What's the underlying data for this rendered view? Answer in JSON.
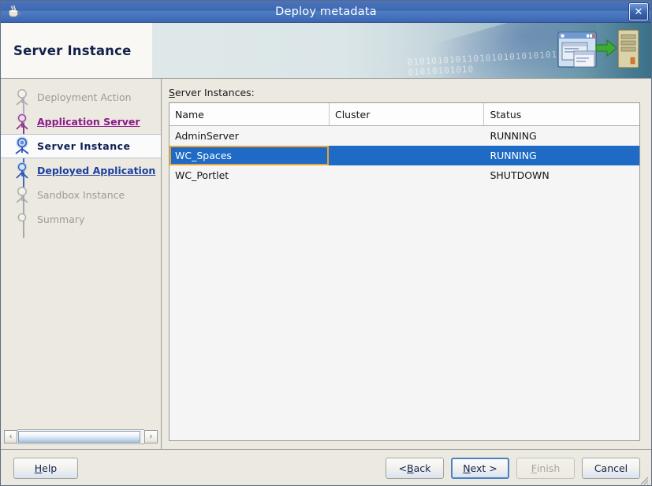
{
  "window": {
    "title": "Deploy metadata",
    "app_icon": "java-coffee-cup-icon",
    "close_label": "✕"
  },
  "banner": {
    "title": "Server Instance",
    "binary_line1": "0101010101101010101010101010",
    "binary_line2": "01010101010",
    "art_icon": "deploy-to-server-icon"
  },
  "sidebar": {
    "steps": [
      {
        "label": "Deployment Action",
        "state": "future"
      },
      {
        "label": "Application Server",
        "state": "done"
      },
      {
        "label": "Server Instance",
        "state": "current"
      },
      {
        "label": "Deployed Application",
        "state": "done-blue"
      },
      {
        "label": "Sandbox Instance",
        "state": "future"
      },
      {
        "label": "Summary",
        "state": "future"
      }
    ],
    "scrollbar": {
      "left_arrow": "‹",
      "right_arrow": "›"
    }
  },
  "main": {
    "field_label_mnemonic": "S",
    "field_label_rest": "erver Instances:",
    "table": {
      "columns": [
        "Name",
        "Cluster",
        "Status"
      ],
      "rows": [
        {
          "name": "AdminServer",
          "cluster": "",
          "status": "RUNNING",
          "selected": false
        },
        {
          "name": "WC_Spaces",
          "cluster": "",
          "status": "RUNNING",
          "selected": true
        },
        {
          "name": "WC_Portlet",
          "cluster": "",
          "status": "SHUTDOWN",
          "selected": false
        }
      ]
    }
  },
  "footer": {
    "help": {
      "mnemonic": "H",
      "pre": "",
      "rest": "elp"
    },
    "back": {
      "pre": "< ",
      "mnemonic": "B",
      "rest": "ack"
    },
    "next": {
      "pre": "",
      "mnemonic": "N",
      "rest": "ext >"
    },
    "finish": {
      "pre": "",
      "mnemonic": "F",
      "rest": "inish",
      "disabled": true
    },
    "cancel": {
      "pre": "Cancel",
      "mnemonic": "",
      "rest": ""
    }
  },
  "colors": {
    "titlebar_blue": "#3f68b3",
    "selection_blue": "#1e6ac4",
    "focus_orange": "#e8a33d",
    "panel_beige": "#ece9e0",
    "link_purple": "#8b1a8b",
    "link_blue": "#1b3fa0"
  }
}
